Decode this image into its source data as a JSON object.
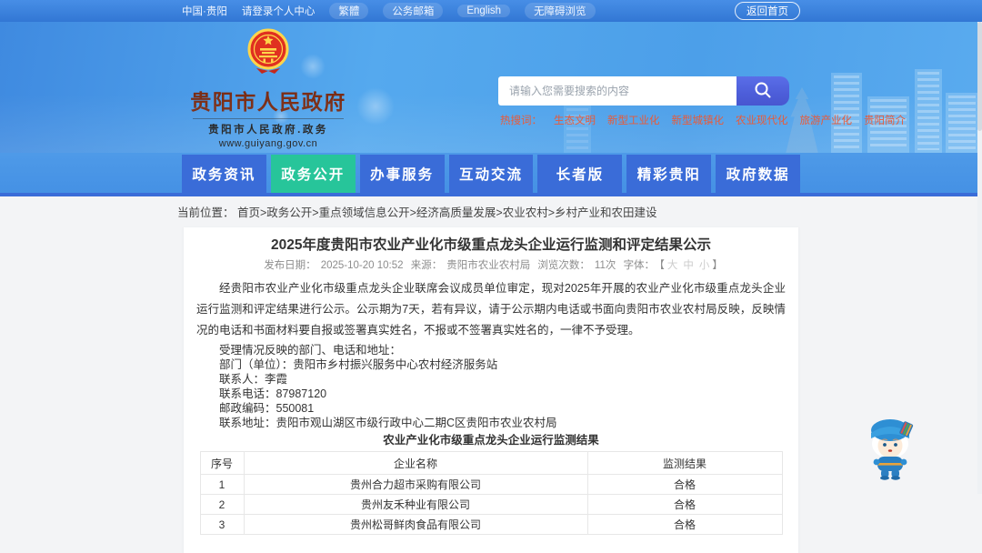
{
  "topbar": {
    "links": [
      "中国·贵阳",
      "请登录个人中心",
      "繁體",
      "公务邮箱",
      "English",
      "无障碍浏览"
    ],
    "home_button": "返回首页"
  },
  "header": {
    "site_name": "贵阳市人民政府",
    "site_subtitle": "贵阳市人民政府.政务",
    "site_url": "www.guiyang.gov.cn",
    "search": {
      "placeholder": "请输入您需要搜索的内容",
      "button_icon": "magnifier-icon"
    },
    "hot_search": {
      "label": "热搜词：",
      "words": [
        "生态文明",
        "新型工业化",
        "新型城镇化",
        "农业现代化",
        "旅游产业化",
        "贵阳简介"
      ]
    }
  },
  "nav": {
    "items": [
      {
        "label": "政务资讯",
        "active": false
      },
      {
        "label": "政务公开",
        "active": true
      },
      {
        "label": "办事服务",
        "active": false
      },
      {
        "label": "互动交流",
        "active": false
      },
      {
        "label": "长者版",
        "active": false
      },
      {
        "label": "精彩贵阳",
        "active": false
      },
      {
        "label": "政府数据",
        "active": false
      }
    ]
  },
  "breadcrumb": {
    "label": "当前位置：",
    "path": "首页>政务公开>重点领域信息公开>经济高质量发展>农业农村>乡村产业和农田建设"
  },
  "article": {
    "title": "2025年度贵阳市农业产业化市级重点龙头企业运行监测和评定结果公示",
    "meta": {
      "date_label": "发布日期：",
      "date": "2025-10-20 10:52",
      "source_label": "来源：",
      "source": "贵阳市农业农村局",
      "views_label": "浏览次数：",
      "views": "11次",
      "font_label": "字体：",
      "bracket_open": "【",
      "font_sizes": [
        "大",
        "中",
        "小"
      ],
      "bracket_close": "】"
    },
    "paragraph": "经贵阳市农业产业化市级重点龙头企业联席会议成员单位审定，现对2025年开展的农业产业化市级重点龙头企业运行监测和评定结果进行公示。公示期为7天，若有异议，请于公示期内电话或书面向贵阳市农业农村局反映，反映情况的电话和书面材料要自报或签署真实姓名，不报或不签署真实姓名的，一律不予受理。",
    "contact_lines": [
      "受理情况反映的部门、电话和地址：",
      "部门（单位）：贵阳市乡村振兴服务中心农村经济服务站",
      "联系人：李霞",
      "联系电话：87987120",
      "邮政编码：550081",
      "联系地址：贵阳市观山湖区市级行政中心二期C区贵阳市农业农村局"
    ],
    "table": {
      "caption": "农业产业化市级重点龙头企业运行监测结果",
      "headers": [
        "序号",
        "企业名称",
        "监测结果"
      ],
      "rows": [
        [
          "1",
          "贵州合力超市采购有限公司",
          "合格"
        ],
        [
          "2",
          "贵州友禾种业有限公司",
          "合格"
        ],
        [
          "3",
          "贵州松哥鲜肉食品有限公司",
          "合格"
        ]
      ]
    }
  },
  "colors": {
    "topbar_blue": "#3c82dd",
    "banner_blue": "#55a9ee",
    "nav_item_blue": "#3a6cd8",
    "nav_active_green": "#27c59a",
    "site_title_maroon": "#7b2d15",
    "hot_word_red": "#e8532f",
    "search_button_blue": "#4b5cd9",
    "emblem_red": "#de2910",
    "emblem_gold": "#ffd54a"
  }
}
